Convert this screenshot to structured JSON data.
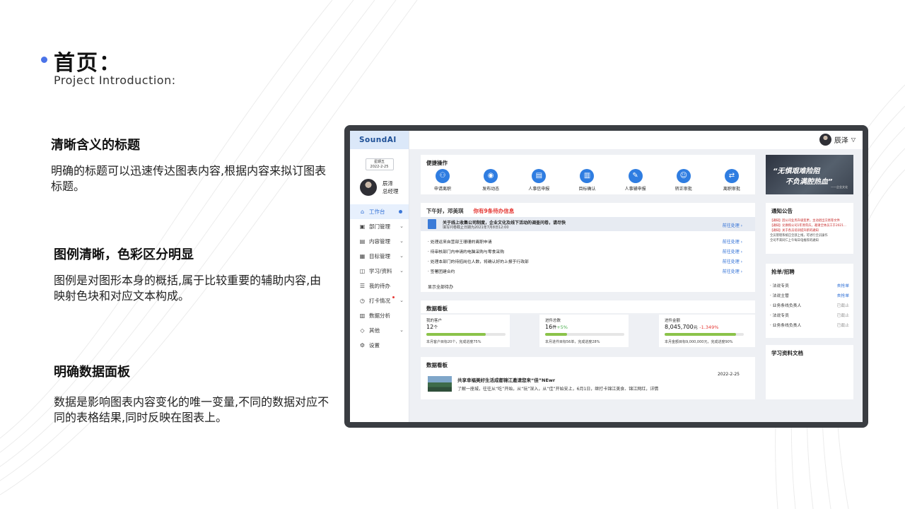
{
  "slide": {
    "title": "首页：",
    "subtitle": "Project Introduction:",
    "sections": [
      {
        "heading": "清晰含义的标题",
        "body": "明确的标题可以迅速传达图表内容,根据内容来拟订图表标题。"
      },
      {
        "heading": "图例清晰，色彩区分明显",
        "body": "图例是对图形本身的概括,属于比较重要的辅助内容,由映射色块和对应文本构成。"
      },
      {
        "heading": "明确数据面板",
        "body": "数据是影响图表内容变化的唯一变量,不同的数据对应不同的表格结果,同时反映在图表上。"
      }
    ]
  },
  "app": {
    "logo": "SoundAI",
    "date_weekday": "星期五",
    "date": "2022-2-25",
    "user_name": "辰泽",
    "user_role": "总经理",
    "top_user": "辰泽",
    "nav": [
      {
        "label": "工作台",
        "icon": "home-icon"
      },
      {
        "label": "部门管理",
        "icon": "department-icon"
      },
      {
        "label": "内容管理",
        "icon": "content-icon"
      },
      {
        "label": "目标管理",
        "icon": "target-icon"
      },
      {
        "label": "学习/资料",
        "icon": "study-icon"
      },
      {
        "label": "我的待办",
        "icon": "todo-icon"
      },
      {
        "label": "打卡情况",
        "icon": "checkin-icon"
      },
      {
        "label": "数据分析",
        "icon": "analytics-icon"
      },
      {
        "label": "其他",
        "icon": "other-icon"
      },
      {
        "label": "设置",
        "icon": "settings-icon"
      }
    ],
    "quick": {
      "title": "便捷操作",
      "items": [
        {
          "label": "申请离职",
          "icon": "resign-icon"
        },
        {
          "label": "发布动态",
          "icon": "post-icon"
        },
        {
          "label": "人事信申报",
          "icon": "hr-report-icon"
        },
        {
          "label": "目标确认",
          "icon": "goal-confirm-icon"
        },
        {
          "label": "人事辅申报",
          "icon": "hr-aux-icon"
        },
        {
          "label": "转正审批",
          "icon": "regularize-icon"
        },
        {
          "label": "离职审批",
          "icon": "resign-approve-icon"
        }
      ]
    },
    "todo": {
      "greeting": "下午好，邓美琪",
      "alert": "你有9条待办信息",
      "highlight_title": "关于线上收集公司制度，企业文化及线下活动的调查问卷，请尽快",
      "highlight_sub": "填写问卷截止日期为2021年7月8日12:00",
      "go": "前往处理 ›",
      "rows": [
        "· 处理运来自营部王珊珊的离职申请",
        "· 待审核部门内申请的电脑采购与零食采购",
        "· 处理本部门的待招岗位人数，将确认好的上报于行政部",
        "· 签署团建合约"
      ],
      "more": "显示全部待办"
    },
    "board": {
      "title": "数据看板",
      "stats": [
        {
          "label": "我的客户",
          "value": "12",
          "unit": "个",
          "delta": "",
          "progress": 0.75,
          "foot": "本月客户目标20个，完成进度75%"
        },
        {
          "label": "进件总数",
          "value": "16",
          "unit": "件",
          "delta": "+5%",
          "progress": 0.28,
          "foot": "本月进件目标56单，完成进度28%"
        },
        {
          "label": "进件金额",
          "value": "8,045,700",
          "unit": "元",
          "delta": "-1.349%",
          "progress": 0.9,
          "foot": "本月金额目标9,000,000元，完成进度90%"
        }
      ]
    },
    "news": {
      "title": "数据看板",
      "date": "2022-2-25",
      "headline": "共享幸福美好生活成都锦江邀请您来“佳”NEwr",
      "text": "了解一座城，往往从“吃”开始，从“玩”深入，从“佳”开始安上，6月1日，继打卡锦江美食、锦江网红，详情"
    },
    "banner": {
      "line1": "“无惧艰难险阻",
      "line2": "不负满腔热血”",
      "small": "——企业文化"
    },
    "notice": {
      "title": "通知公告",
      "lines": [
        {
          "text": "【通知】因公司业务升级变更，主动退出交易等文件",
          "red": true
        },
        {
          "text": "【通知】兑换购公司1年周年庆，邀请全体员工于2021...",
          "red": true
        },
        {
          "text": "【通知】关于各员培训提升新的通知",
          "red": true
        },
        {
          "text": "全员管理系统已全部上线，可进行全员操作",
          "red": false
        },
        {
          "text": "全司不来同仁上午每日电推荐的通知",
          "red": false
        }
      ]
    },
    "grab": {
      "title": "抢单/招聘",
      "rows": [
        {
          "label": "· 法说专员",
          "action": "去抢单",
          "active": true
        },
        {
          "label": "· 法说主管",
          "action": "去抢单",
          "active": true
        },
        {
          "label": "· 业务条线负责人",
          "action": "已截止",
          "active": false
        },
        {
          "label": "· 法说专员",
          "action": "已截止",
          "active": false
        },
        {
          "label": "· 业务条线负责人",
          "action": "已截止",
          "active": false
        }
      ]
    },
    "study": {
      "title": "学习资料文档"
    }
  },
  "colors": {
    "accent": "#2f7de1",
    "alert": "#e53935",
    "dot": "#4a73e8"
  }
}
